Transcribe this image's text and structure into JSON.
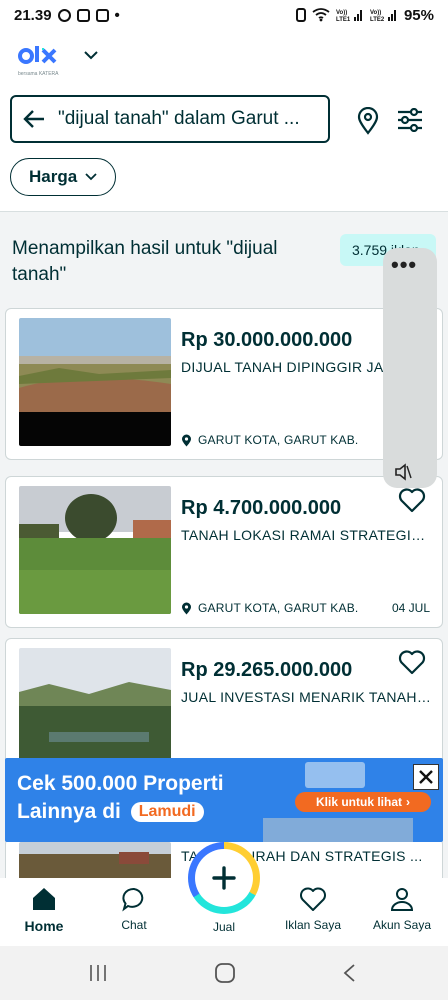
{
  "status_bar": {
    "time": "21.39",
    "signal_labels": [
      "Vo))\nLTE1",
      "Vo))\nLTE2"
    ],
    "battery": "95%"
  },
  "brand": {
    "logo_text": "olx",
    "logo_subtext": "bersama KATERA",
    "accent": "#3a77ff"
  },
  "search": {
    "query_text": "\"dijual tanah\" dalam Garut ...",
    "back_icon": "arrow-left-icon",
    "location_icon": "map-pin-icon",
    "filter_icon": "sliders-icon"
  },
  "filters": {
    "price_chip": "Harga"
  },
  "results": {
    "heading": "Menampilkan hasil untuk \"dijual tanah\"",
    "count": "3.759 iklan"
  },
  "listings": [
    {
      "price": "Rp 30.000.000.000",
      "title": "DIJUAL TANAH DIPINGGIR JALAN",
      "location": "GARUT KOTA, GARUT KAB.",
      "date": ""
    },
    {
      "price": "Rp 4.700.000.000",
      "title": "TANAH LOKASI RAMAI STRATEGIS...",
      "location": "GARUT KOTA, GARUT KAB.",
      "date": "04 JUL"
    },
    {
      "price": "Rp 29.265.000.000",
      "title": "JUAL INVESTASI MENARIK TANAH ...",
      "location": "",
      "date": ""
    },
    {
      "price": "",
      "title": "TANAH MURAH DAN STRATEGIS ...",
      "location": "",
      "date": ""
    }
  ],
  "ad_banner": {
    "line1": "Cek 500.000 Properti",
    "line2": "Lainnya di",
    "brand": "Lamudi",
    "cta": "Klik untuk lihat"
  },
  "bottom_nav": {
    "items": [
      {
        "label": "Home",
        "icon": "home-icon"
      },
      {
        "label": "Chat",
        "icon": "chat-icon"
      },
      {
        "label": "Jual",
        "icon": "plus-icon"
      },
      {
        "label": "Iklan Saya",
        "icon": "heart-icon"
      },
      {
        "label": "Akun Saya",
        "icon": "user-icon"
      }
    ]
  },
  "colors": {
    "primary_text": "#002f34",
    "badge_bg": "#c8f8f6",
    "ad_bg": "#2f82e8",
    "ad_cta": "#f26a21"
  }
}
